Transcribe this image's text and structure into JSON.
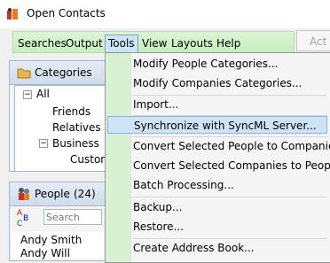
{
  "window": {
    "title": "Open Contacts"
  },
  "menubar": {
    "items": [
      "Searches",
      "Output",
      "Tools",
      "View",
      "Layouts",
      "Help"
    ],
    "actions_label": "Act"
  },
  "categories": {
    "header": "Categories",
    "tree": [
      "All",
      "Friends",
      "Relatives",
      "Business",
      "Custon"
    ]
  },
  "people": {
    "header": "People",
    "count": "(24)",
    "search_placeholder": "Search",
    "list": [
      "Andy Smith",
      "Andy Will"
    ]
  },
  "tools_menu": {
    "items": [
      "Modify People Categories...",
      "Modify Companies Categories...",
      "Import...",
      "Synchronize with SyncML Server...",
      "Convert Selected People to Companies",
      "Convert Selected Companies to People",
      "Batch Processing...",
      "Backup...",
      "Restore...",
      "Create Address Book..."
    ],
    "highlighted": "Synchronize with SyncML Server..."
  },
  "colors": {
    "menu_green": "#c7eec0",
    "highlight": "#cfe3f7",
    "panel_blue": "#cfdcec"
  }
}
